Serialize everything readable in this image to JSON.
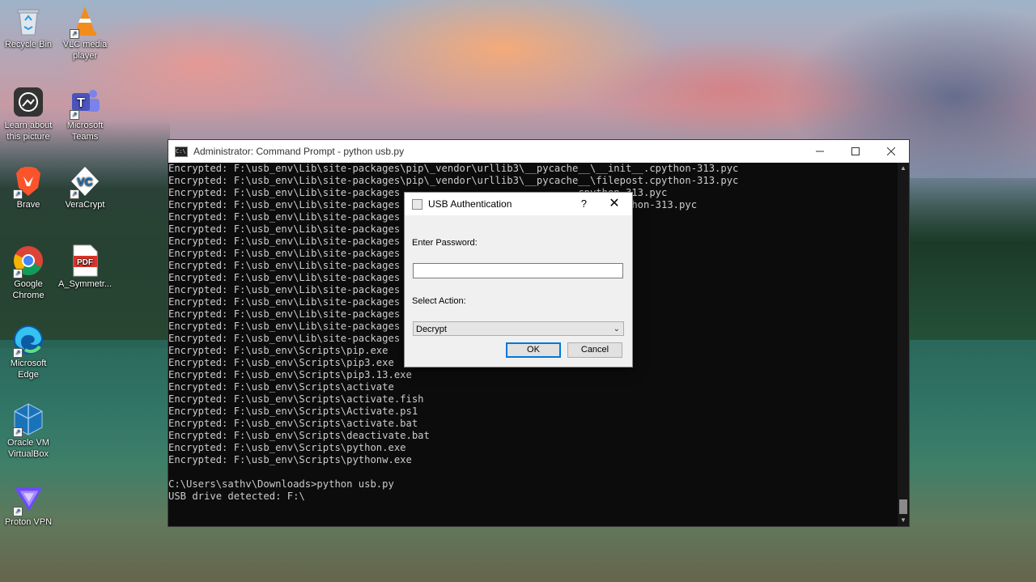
{
  "desktop": {
    "icons": [
      {
        "label": "Recycle Bin",
        "icon": "recycle-bin-icon"
      },
      {
        "label": "VLC media player",
        "icon": "vlc-icon"
      },
      {
        "label": "Learn about this picture",
        "icon": "learn-about-picture-icon"
      },
      {
        "label": "Microsoft Teams",
        "icon": "teams-icon"
      },
      {
        "label": "Brave",
        "icon": "brave-icon"
      },
      {
        "label": "VeraCrypt",
        "icon": "veracrypt-icon"
      },
      {
        "label": "Google Chrome",
        "icon": "chrome-icon"
      },
      {
        "label": "A_Symmetr...",
        "icon": "pdf-icon"
      },
      {
        "label": "Microsoft Edge",
        "icon": "edge-icon"
      },
      {
        "label": "Oracle VM VirtualBox",
        "icon": "virtualbox-icon"
      },
      {
        "label": "Proton VPN",
        "icon": "protonvpn-icon"
      }
    ]
  },
  "cmd_window": {
    "title": "Administrator: Command Prompt - python  usb.py",
    "lines": [
      "Encrypted: F:\\usb_env\\Lib\\site-packages\\pip\\_vendor\\urllib3\\__pycache__\\__init__.cpython-313.pyc",
      "Encrypted: F:\\usb_env\\Lib\\site-packages\\pip\\_vendor\\urllib3\\__pycache__\\filepost.cpython-313.pyc",
      "Encrypted: F:\\usb_env\\Lib\\site-packages                             .cpython-313.pyc",
      "Encrypted: F:\\usb_env\\Lib\\site-packages                             sions.cpython-313.pyc",
      "Encrypted: F:\\usb_env\\Lib\\site-packages                             .pyc",
      "Encrypted: F:\\usb_env\\Lib\\site-packages                             .pyc",
      "Encrypted: F:\\usb_env\\Lib\\site-packages                             on-313.pyc",
      "Encrypted: F:\\usb_env\\Lib\\site-packages",
      "Encrypted: F:\\usb_env\\Lib\\site-packages",
      "Encrypted: F:\\usb_env\\Lib\\site-packages",
      "Encrypted: F:\\usb_env\\Lib\\site-packages",
      "Encrypted: F:\\usb_env\\Lib\\site-packages",
      "Encrypted: F:\\usb_env\\Lib\\site-packages",
      "Encrypted: F:\\usb_env\\Lib\\site-packages",
      "Encrypted: F:\\usb_env\\Lib\\site-packages",
      "Encrypted: F:\\usb_env\\Scripts\\pip.exe",
      "Encrypted: F:\\usb_env\\Scripts\\pip3.exe",
      "Encrypted: F:\\usb_env\\Scripts\\pip3.13.exe",
      "Encrypted: F:\\usb_env\\Scripts\\activate",
      "Encrypted: F:\\usb_env\\Scripts\\activate.fish",
      "Encrypted: F:\\usb_env\\Scripts\\Activate.ps1",
      "Encrypted: F:\\usb_env\\Scripts\\activate.bat",
      "Encrypted: F:\\usb_env\\Scripts\\deactivate.bat",
      "Encrypted: F:\\usb_env\\Scripts\\python.exe",
      "Encrypted: F:\\usb_env\\Scripts\\pythonw.exe",
      "",
      "C:\\Users\\sathv\\Downloads>python usb.py",
      "USB drive detected: F:\\"
    ]
  },
  "dialog": {
    "title": "USB Authentication",
    "help": "?",
    "close": "✕",
    "password_label": "Enter Password:",
    "password_value": "",
    "action_label": "Select Action:",
    "action_selected": "Decrypt",
    "ok_label": "OK",
    "cancel_label": "Cancel"
  }
}
